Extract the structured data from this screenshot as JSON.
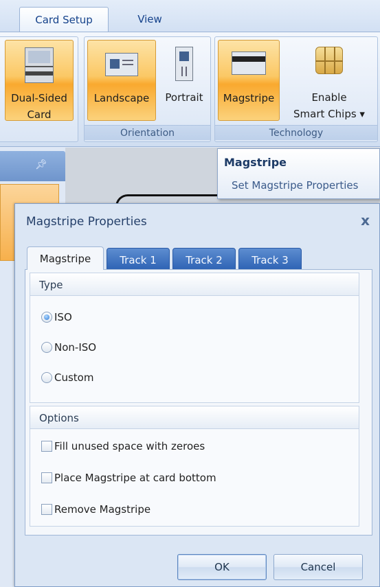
{
  "ribbon": {
    "tabs": [
      {
        "label": "Card Setup",
        "active": true
      },
      {
        "label": "View",
        "active": false
      }
    ],
    "buttons": {
      "dual_sided": {
        "line1": "Dual-Sided",
        "line2": "Card"
      },
      "landscape": "Landscape",
      "portrait": "Portrait",
      "magstripe": "Magstripe",
      "smart_chips": {
        "line1": "Enable",
        "line2": "Smart Chips ▾"
      }
    },
    "groups": {
      "orientation": "Orientation",
      "technology": "Technology"
    }
  },
  "tooltip": {
    "title": "Magstripe",
    "body": "Set Magstripe Properties"
  },
  "dialog": {
    "title": "Magstripe Properties",
    "close": "x",
    "tabs": [
      "Magstripe",
      "Track 1",
      "Track 2",
      "Track 3"
    ],
    "type_section": {
      "header": "Type",
      "options": [
        "ISO",
        "Non-ISO",
        "Custom"
      ],
      "selected": "ISO"
    },
    "options_section": {
      "header": "Options",
      "checkboxes": [
        {
          "label": "Fill unused space with zeroes",
          "checked": false
        },
        {
          "label": "Place Magstripe at card bottom",
          "checked": false
        },
        {
          "label": "Remove Magstripe",
          "checked": false
        }
      ]
    },
    "buttons": {
      "ok": "OK",
      "cancel": "Cancel"
    }
  },
  "colors": {
    "accent_orange": "#f9a92f",
    "tab_blue": "#2f64b5",
    "dialog_bg": "#dbe6f4"
  }
}
